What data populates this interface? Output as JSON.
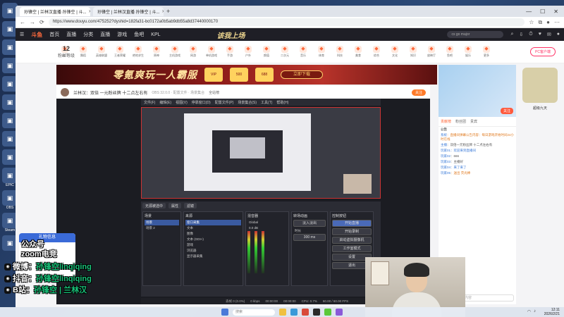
{
  "desktop": {
    "icons": [
      {
        "icon": "recycle-bin-icon",
        "label": ""
      },
      {
        "icon": "folder-icon",
        "label": ""
      },
      {
        "icon": "app-icon",
        "label": ""
      },
      {
        "icon": "edge-icon",
        "label": ""
      },
      {
        "icon": "store-icon",
        "label": ""
      },
      {
        "icon": "nvidia-icon",
        "label": ""
      },
      {
        "icon": "app-icon",
        "label": ""
      },
      {
        "icon": "app-icon",
        "label": ""
      },
      {
        "icon": "app-icon",
        "label": ""
      },
      {
        "icon": "app-icon",
        "label": "EPIC"
      },
      {
        "icon": "app-icon",
        "label": "OBS"
      },
      {
        "icon": "steam-icon",
        "label": "Steam"
      },
      {
        "icon": "app-icon",
        "label": ""
      }
    ]
  },
  "browser": {
    "tabs": [
      {
        "label": "孙锋空 | 兰林汉直播 孙锋空 | 斗..."
      },
      {
        "label": "孙锋空 | 兰林汉直播 孙锋空 | 斗..."
      }
    ],
    "url": "https://www.douyu.com/475252?dyshid=182fa31-bc0172a0b5ab9db55a8d37440000170",
    "controls": {
      "minimize": "—",
      "maximize": "☐",
      "close": "✕"
    }
  },
  "site": {
    "logo": "斗鱼",
    "nav": [
      "首页",
      "直播",
      "分类",
      "直播",
      "游戏",
      "鱼吧",
      "KPL"
    ],
    "promo": "该我上场",
    "search_placeholder": "cs go major",
    "level": {
      "value": "12",
      "label": "粉丝等级"
    },
    "categories": [
      "热门",
      "舞蹈",
      "英雄联盟",
      "王者荣耀",
      "绝地求生",
      "原神",
      "主机游戏",
      "网游",
      "单机游戏",
      "手游",
      "户外",
      "颜值",
      "二次元",
      "音乐",
      "体育",
      "科技",
      "美食",
      "综合",
      "文化",
      "知识",
      "放映厅",
      "鱼吧",
      "娱乐",
      "更多"
    ],
    "vip_label": "PC客户端",
    "banner": {
      "title": "零氪爽玩一人霸服",
      "chips": [
        "VIP",
        "500",
        "688"
      ],
      "cta": "立即下载"
    },
    "room": {
      "streamer": "兰林汉",
      "title": "兰林汉：双倍 一元粉丝牌 十二点左右有",
      "sub": "OBS 32.0.0 · 配置文件 · 场景集合",
      "follow": "关注",
      "stat": "全站榜"
    }
  },
  "obs": {
    "menu": [
      "文件(F)",
      "编辑(E)",
      "视图(V)",
      "停靠窗口(D)",
      "配置文件(P)",
      "场景集合(S)",
      "工具(T)",
      "帮助(H)"
    ],
    "dock_tabs": [
      "场景",
      "来源",
      "混音器",
      "转场动画",
      "控制按钮"
    ],
    "toolbar": [
      "无源被选中",
      "属性",
      "滤镜"
    ],
    "scenes": [
      "场景",
      "场景 2"
    ],
    "sources": [
      "窗口采集",
      "文本",
      "图像",
      "文本 (GDI+)",
      "游戏",
      "浏览器",
      "显示器采集"
    ],
    "mixer": [
      {
        "name": "Global",
        "level": "0.0 dB"
      },
      {
        "name": "麦克风",
        "level": "0.0 dB"
      }
    ],
    "transition": {
      "type": "淡入淡出",
      "duration_label": "时长",
      "duration": "300 ms"
    },
    "controls": [
      "开始直播",
      "开始录制",
      "启动虚拟摄像机",
      "工作室模式",
      "设置",
      "退出"
    ],
    "status": [
      "丢帧 0 (0.0%)",
      "0 kbps",
      "00:00:00",
      "00:00:00",
      "CPU: 0.7%",
      "60.00 / 60.00 FPS"
    ]
  },
  "chat": {
    "tabs": [
      "贡献榜",
      "粉丝团",
      "贵宾"
    ],
    "notice_title": "公告",
    "lines": [
      {
        "name": "系统",
        "text": "直播间弹幕公告内容：每日游戏开始时间24小时在线",
        "style": "orange"
      },
      {
        "name": "主播",
        "text": "双倍一元粉丝牌 十二点左右有",
        "style": ""
      },
      {
        "name": "玩家01",
        "text": "欢迎来到直播间",
        "style": "blue"
      },
      {
        "name": "玩家02",
        "text": "666",
        "style": ""
      },
      {
        "name": "玩家03",
        "text": "主播好",
        "style": ""
      },
      {
        "name": "玩家04",
        "text": "来了来了",
        "style": "blue"
      },
      {
        "name": "玩家05",
        "text": "送出 荧光棒",
        "style": "orange"
      }
    ],
    "input_placeholder": "这里输入聊天内容"
  },
  "rail": {
    "label": "超级九天"
  },
  "overlay": {
    "gift_panel_title": "礼物信息",
    "lines": [
      {
        "icon": "wechat-icon",
        "text_a": "公众号",
        "text_b": "",
        "prefix": ""
      },
      {
        "icon": "zoom-icon",
        "text_a": "zoom电竞",
        "text_b": "",
        "prefix": ""
      },
      {
        "icon": "weibo-icon",
        "text_a": "微博：",
        "text_b": "孙锋空linqiqing",
        "prefix": ""
      },
      {
        "icon": "bilibili-icon",
        "text_a": "抖音：",
        "text_b": "孙锋空linqiqing",
        "prefix": ""
      },
      {
        "icon": "douyin-icon",
        "text_a": "B站：",
        "text_b": "孙锋空 | 兰林汉",
        "prefix": ""
      }
    ]
  },
  "taskbar": {
    "search_placeholder": "搜索",
    "time": "12:11",
    "date": "2026/2/21"
  }
}
